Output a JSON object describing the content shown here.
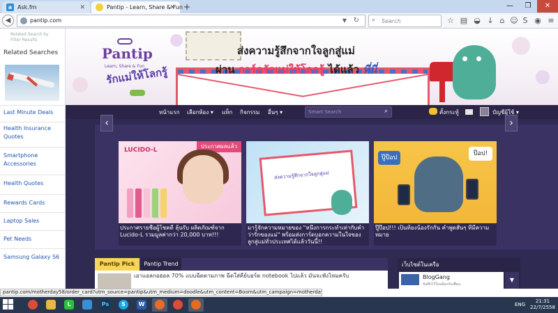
{
  "browser": {
    "tabs": [
      {
        "title": "Ask.fm",
        "icon": "askfm-icon"
      },
      {
        "title": "Pantip - Learn, Share & Fun",
        "icon": "pantip-smiley-icon"
      }
    ],
    "url": "pantip.com",
    "search_placeholder": "Search",
    "status_url": "pantip.com/motherday58/order_card?utm_source=pantip&utm_medium=doodle&utm_content=Boom&utm_campaign=motherday58/order_card"
  },
  "sidebar": {
    "small_text": "Related Search by Filter Results",
    "title": "Related Searches",
    "links": [
      "Last Minute Deals",
      "Health Insurance Quotes",
      "Smartphone Accessories",
      "Health Quotes",
      "Rewards Cards",
      "Laptop Sales",
      "Pet Needs",
      "Samsung Galaxy S6"
    ]
  },
  "banner": {
    "logo_name": "Pantip",
    "logo_tagline": "Learn, Share & Fun",
    "love_title": "รักแม่ให้โลกรู้",
    "headline_line1": "ส่งความรู้สึกจากใจลูกสู่แม่",
    "headline_line2_a": "ผ่าน ",
    "headline_line2_b": "การ์ดรักแม่ให้โลกรู้",
    "headline_line2_c": " ได้แล้ว ",
    "headline_line2_d": "ที่นี่"
  },
  "sitenav": {
    "items": [
      "หน้าแรก",
      "เลือกห้อง ▾",
      "แท็ก",
      "กิจกรรม",
      "อื่นๆ ▾"
    ],
    "search_placeholder": "Smart Search",
    "right_items": [
      "ตั้งกระทู้",
      "บัญชีผู้ใช้ ▾"
    ]
  },
  "carousel": {
    "cards": [
      {
        "badge": "ประกาศผลแล้ว",
        "brand": "LUCIDO-L",
        "title": "ประกาศรายชื่อผู้โชคดี ลุ้นรับ ผลิตภัณฑ์จาก Lucido-L รวมมูลค่ากว่า 20,000 บาท!!!"
      },
      {
        "letter_text": "ส่งความรู้สึกจากใจลูกสู่แม่",
        "title": "มารู้จักความหมายของ \"หนึ่งการกระทำเท่ากับคำว่ารักของแม่\" พร้อมส่งการ์ดบอกความในใจของลูกสู่แม่ทั่วประเทศได้แล้ววันนี้!!"
      },
      {
        "pop_label_left": "ปู๊ป๊อป",
        "pop_label_right": "ป๊อป!",
        "title": "ปู๊ป๊อป!!! เป็นท้องน้องรักกัน คำพูดสั้นๆ ที่มีความหมาย"
      }
    ]
  },
  "pick": {
    "tab_active": "Pantip Pick",
    "tab_other": "Pantip Trend",
    "text": "เอาแอลกอฮอล 70% แบบฉีดตามภาพ ฉีดใส่คีย์บอร์ด notebook ไปแล้ว มันจะพังไหมครับ"
  },
  "sites": {
    "title": "เว็บไซต์ในเครือ",
    "name": "BlogGang",
    "sub": "บันทึกไว้ในบล็อกกับเพื่อน"
  },
  "taskbar": {
    "apps": [
      "chrome",
      "explorer",
      "line",
      "store",
      "photoshop",
      "skype",
      "word",
      "firefox-active",
      "chrome-2",
      "firefox"
    ],
    "lang": "ENG",
    "time": "21:31",
    "date": "22/7/2558"
  },
  "colors": {
    "page_bg": "#2f2a52",
    "accent_yellow": "#f7d55a",
    "link_blue": "#1f54b0",
    "taskbar": "#28374f"
  }
}
